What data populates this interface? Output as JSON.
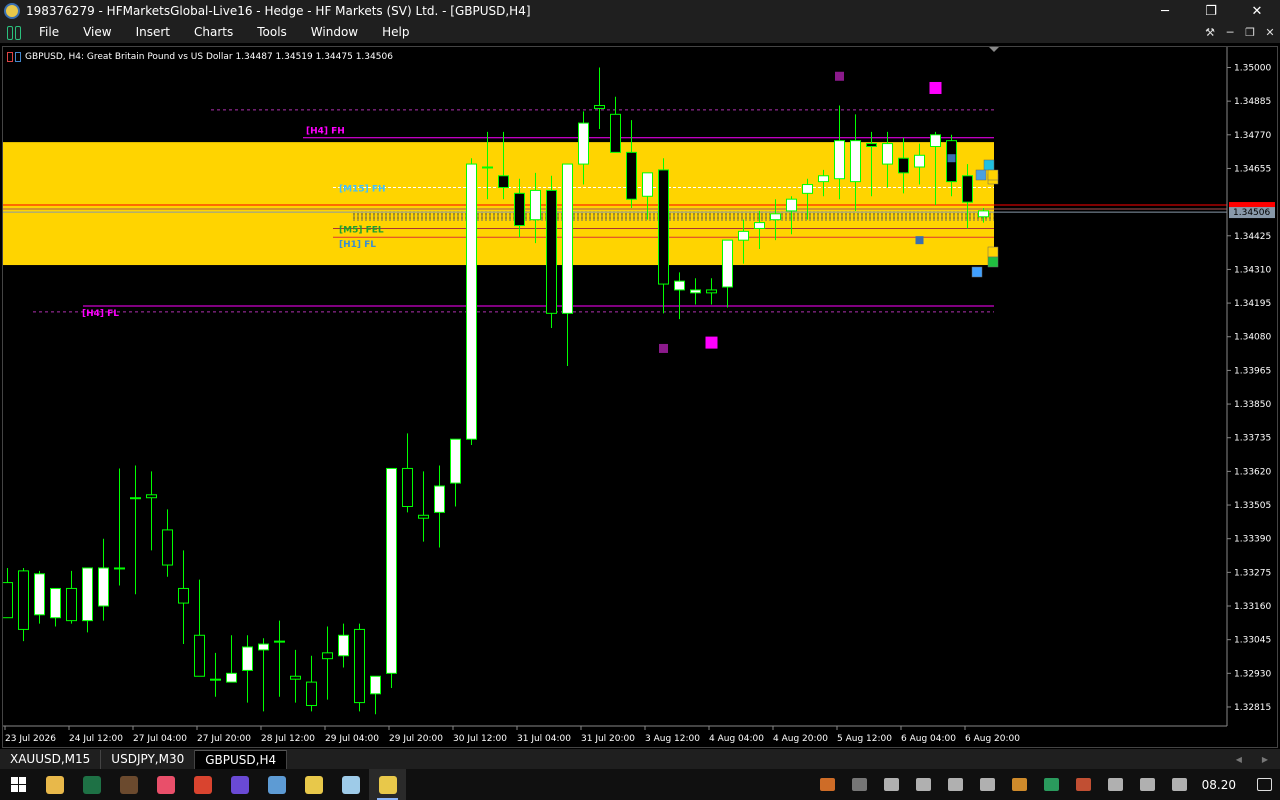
{
  "window": {
    "title": "198376279 - HFMarketsGlobal-Live16 - Hedge - HF Markets (SV) Ltd. - [GBPUSD,H4]",
    "minimize": "─",
    "maximize": "❐",
    "close": "✕"
  },
  "menu": {
    "items": [
      "File",
      "View",
      "Insert",
      "Charts",
      "Tools",
      "Window",
      "Help"
    ],
    "mdi": [
      "⚒",
      "─",
      "❐",
      "✕"
    ]
  },
  "chart": {
    "info": "GBPUSD, H4:  Great Britain Pound vs US Dollar  1.34487 1.34519 1.34475 1.34506",
    "current_price": "1.34506",
    "price_axis": [
      "1.35000",
      "1.34885",
      "1.34770",
      "1.34655",
      "1.34425",
      "1.34310",
      "1.34195",
      "1.34080",
      "1.33965",
      "1.33850",
      "1.33735",
      "1.33620",
      "1.33505",
      "1.33390",
      "1.33275",
      "1.33160",
      "1.33045",
      "1.32930",
      "1.32815"
    ],
    "time_axis": [
      "23 Jul 2026",
      "24 Jul 12:00",
      "27 Jul 04:00",
      "27 Jul 20:00",
      "28 Jul 12:00",
      "29 Jul 04:00",
      "29 Jul 20:00",
      "30 Jul 12:00",
      "31 Jul 04:00",
      "31 Jul 20:00",
      "3 Aug 12:00",
      "4 Aug 04:00",
      "4 Aug 20:00",
      "5 Aug 12:00",
      "6 Aug 04:00",
      "6 Aug 20:00"
    ],
    "zone_labels": {
      "h4_fh": "[H4] FH",
      "h4_fl": "[H4] FL",
      "m15_fh": "[M15] FH",
      "m5_fel": "[M5] FEL",
      "h1_fl": "[H1] FL"
    },
    "colors": {
      "bull": "#ffffff",
      "bear": "#000000",
      "wick": "#00ff00",
      "zone": "#ffd400",
      "magenta": "#ff00ff",
      "purple": "#8b1a8b",
      "red_line": "#ff0000"
    }
  },
  "chart_data": {
    "type": "candlestick",
    "ylim": [
      1.3275,
      1.3507
    ],
    "price_ticks": [
      1.35,
      1.34885,
      1.3477,
      1.34655,
      1.34425,
      1.3431,
      1.34195,
      1.3408,
      1.33965,
      1.3385,
      1.33735,
      1.3362,
      1.33505,
      1.3339,
      1.33275,
      1.3316,
      1.33045,
      1.3293,
      1.32815
    ],
    "last_price": 1.34506,
    "zone": {
      "high": 1.34745,
      "low": 1.34325
    },
    "levels": {
      "h4_fh": 1.3476,
      "h4_fl": 1.34185,
      "h4_top_dashed": 1.34855,
      "h4_bottom_dashed": 1.34165,
      "m15_fh": 1.3459,
      "m5_fel": 1.3445,
      "h1_fl": 1.3442,
      "red_upper": 1.3453,
      "red_lower": 1.3444
    },
    "candles": [
      [
        1.3324,
        1.3329,
        1.3312,
        1.3312
      ],
      [
        1.3328,
        1.3329,
        1.3304,
        1.3308
      ],
      [
        1.3313,
        1.3328,
        1.331,
        1.3327
      ],
      [
        1.3312,
        1.3322,
        1.3309,
        1.3322
      ],
      [
        1.3322,
        1.3328,
        1.331,
        1.3311
      ],
      [
        1.3311,
        1.3328,
        1.3307,
        1.3329
      ],
      [
        1.3316,
        1.3339,
        1.3311,
        1.3329
      ],
      [
        1.3329,
        1.3363,
        1.3323,
        1.3329
      ],
      [
        1.3353,
        1.3364,
        1.332,
        1.3353
      ],
      [
        1.3354,
        1.3362,
        1.3335,
        1.3353
      ],
      [
        1.3342,
        1.3349,
        1.3326,
        1.333
      ],
      [
        1.3322,
        1.3335,
        1.3303,
        1.3317
      ],
      [
        1.3306,
        1.3325,
        1.3305,
        1.3292
      ],
      [
        1.3291,
        1.33,
        1.3285,
        1.3291
      ],
      [
        1.329,
        1.3306,
        1.329,
        1.3293
      ],
      [
        1.3294,
        1.3306,
        1.3283,
        1.3302
      ],
      [
        1.3301,
        1.3305,
        1.328,
        1.3303
      ],
      [
        1.3304,
        1.3311,
        1.3285,
        1.3304
      ],
      [
        1.3292,
        1.3301,
        1.3283,
        1.3291
      ],
      [
        1.329,
        1.3299,
        1.328,
        1.3282
      ],
      [
        1.33,
        1.3309,
        1.3284,
        1.3298
      ],
      [
        1.3299,
        1.331,
        1.3295,
        1.3306
      ],
      [
        1.3308,
        1.331,
        1.328,
        1.3283
      ],
      [
        1.3286,
        1.3292,
        1.3279,
        1.3292
      ],
      [
        1.3293,
        1.3358,
        1.3288,
        1.3363
      ],
      [
        1.3363,
        1.3375,
        1.3348,
        1.335
      ],
      [
        1.3347,
        1.3362,
        1.3338,
        1.3346
      ],
      [
        1.3348,
        1.3364,
        1.3336,
        1.3357
      ],
      [
        1.3358,
        1.337,
        1.335,
        1.3373
      ],
      [
        1.3373,
        1.3469,
        1.3371,
        1.3467
      ],
      [
        1.3466,
        1.3478,
        1.3455,
        1.3466
      ],
      [
        1.3463,
        1.3478,
        1.3455,
        1.3459
      ],
      [
        1.3457,
        1.3462,
        1.3442,
        1.3446
      ],
      [
        1.3448,
        1.3464,
        1.344,
        1.3458
      ],
      [
        1.3458,
        1.3463,
        1.3411,
        1.3416
      ],
      [
        1.3416,
        1.3462,
        1.3398,
        1.3467
      ],
      [
        1.3467,
        1.3485,
        1.346,
        1.3481
      ],
      [
        1.3487,
        1.35,
        1.3479,
        1.3486
      ],
      [
        1.3484,
        1.349,
        1.3472,
        1.3471
      ],
      [
        1.3471,
        1.3482,
        1.3452,
        1.3455
      ],
      [
        1.3456,
        1.3461,
        1.3448,
        1.3464
      ],
      [
        1.3465,
        1.3469,
        1.3416,
        1.3426
      ],
      [
        1.3424,
        1.343,
        1.3414,
        1.3427
      ],
      [
        1.3423,
        1.3428,
        1.3419,
        1.3424
      ],
      [
        1.3424,
        1.3428,
        1.3419,
        1.3423
      ],
      [
        1.3425,
        1.3441,
        1.3418,
        1.3441
      ],
      [
        1.3441,
        1.3448,
        1.3433,
        1.3444
      ],
      [
        1.3445,
        1.3451,
        1.3438,
        1.3447
      ],
      [
        1.3448,
        1.3455,
        1.3441,
        1.345
      ],
      [
        1.3451,
        1.3456,
        1.3443,
        1.3455
      ],
      [
        1.3457,
        1.3462,
        1.3448,
        1.346
      ],
      [
        1.3461,
        1.3465,
        1.3456,
        1.3463
      ],
      [
        1.3462,
        1.3487,
        1.3455,
        1.3475
      ],
      [
        1.3461,
        1.3484,
        1.3451,
        1.3475
      ],
      [
        1.3474,
        1.3478,
        1.3456,
        1.3473
      ],
      [
        1.3467,
        1.3478,
        1.3459,
        1.3474
      ],
      [
        1.3469,
        1.3476,
        1.3457,
        1.3464
      ],
      [
        1.3466,
        1.3474,
        1.346,
        1.347
      ],
      [
        1.3473,
        1.3478,
        1.3453,
        1.3477
      ],
      [
        1.3475,
        1.3477,
        1.3456,
        1.3461
      ],
      [
        1.3463,
        1.3467,
        1.3445,
        1.3454
      ],
      [
        1.3449,
        1.3452,
        1.3447,
        1.3451
      ]
    ],
    "markers": [
      {
        "c": 52,
        "price": 1.3497,
        "color": "#8b1a8b",
        "size": 9
      },
      {
        "c": 58,
        "price": 1.3493,
        "color": "#ff00ff",
        "size": 12
      },
      {
        "c": 41,
        "price": 1.3404,
        "color": "#8b1a8b",
        "size": 9
      },
      {
        "c": 44,
        "price": 1.3406,
        "color": "#ff00ff",
        "size": 12
      },
      {
        "c": 57,
        "price": 1.3441,
        "color": "#3a6fb0",
        "size": 8
      },
      {
        "c": 59,
        "price": 1.3469,
        "color": "#3a6fb0",
        "size": 8
      }
    ]
  },
  "tabs": {
    "items": [
      "XAUUSD,M15",
      "USDJPY,M30",
      "GBPUSD,H4"
    ],
    "active": 2,
    "left_arrow": "◀",
    "right_arrow": "▶"
  },
  "taskbar": {
    "clock": "08.20",
    "apps": [
      {
        "name": "file-explorer-icon",
        "color": "#e8b84a"
      },
      {
        "name": "excel-icon",
        "color": "#1e7145"
      },
      {
        "name": "minecraft-icon",
        "color": "#6b4a2e"
      },
      {
        "name": "maps-icon",
        "color": "#e94f6a"
      },
      {
        "name": "chrome-icon",
        "color": "#d9442f"
      },
      {
        "name": "app-icon",
        "color": "#6a4ad4"
      },
      {
        "name": "browser-icon",
        "color": "#5d9bd4"
      },
      {
        "name": "trader-icon",
        "color": "#e8c84a"
      },
      {
        "name": "notepad-icon",
        "color": "#9ecbe8"
      },
      {
        "name": "metatrader-icon",
        "color": "#e8c84a"
      }
    ],
    "tray": [
      {
        "name": "cloud-icon",
        "color": "#f07d2b"
      },
      {
        "name": "drive-icon",
        "color": "#888888"
      },
      {
        "name": "device-icon",
        "color": "#cccccc"
      },
      {
        "name": "usb-icon",
        "color": "#cccccc"
      },
      {
        "name": "shield-icon",
        "color": "#cccccc"
      },
      {
        "name": "muted-icon",
        "color": "#cccccc"
      },
      {
        "name": "search-tray-icon",
        "color": "#f0a030"
      },
      {
        "name": "edge-icon",
        "color": "#2fb36b"
      },
      {
        "name": "speaker-icon",
        "color": "#e05a3a"
      },
      {
        "name": "discord-icon",
        "color": "#cccccc"
      },
      {
        "name": "network-icon",
        "color": "#cccccc"
      },
      {
        "name": "pen-icon",
        "color": "#cccccc"
      }
    ]
  }
}
